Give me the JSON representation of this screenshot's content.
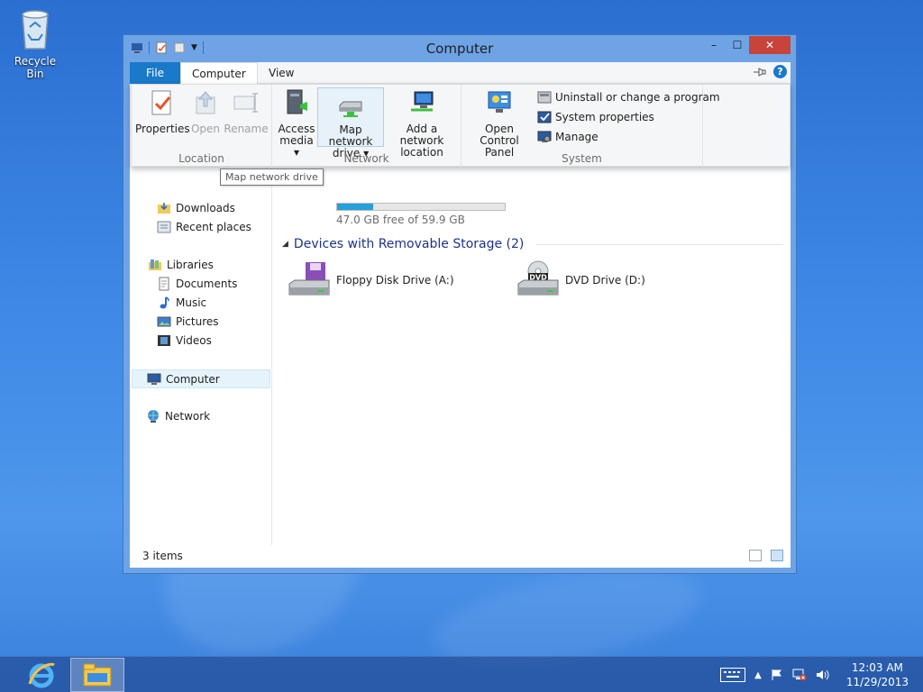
{
  "desktop": {
    "recycle_bin_label": "Recycle Bin"
  },
  "window": {
    "title": "Computer",
    "controls": {
      "minimize": "–",
      "maximize": "☐",
      "close": "✕"
    }
  },
  "ribbon_tabs": {
    "file": "File",
    "computer": "Computer",
    "view": "View"
  },
  "ribbon": {
    "location": {
      "label": "Location",
      "properties": "Properties",
      "open": "Open",
      "rename": "Rename"
    },
    "network": {
      "label": "Network",
      "access_media_l1": "Access",
      "access_media_l2": "media",
      "map_drive_l1": "Map network",
      "map_drive_l2": "drive",
      "add_location_l1": "Add a network",
      "add_location_l2": "location"
    },
    "system": {
      "label": "System",
      "control_panel_l1": "Open Control",
      "control_panel_l2": "Panel",
      "uninstall": "Uninstall or change a program",
      "system_properties": "System properties",
      "manage": "Manage"
    }
  },
  "tooltip": "Map network drive",
  "nav": {
    "downloads": "Downloads",
    "recent_places": "Recent places",
    "libraries": "Libraries",
    "documents": "Documents",
    "music": "Music",
    "pictures": "Pictures",
    "videos": "Videos",
    "computer": "Computer",
    "network": "Network"
  },
  "main": {
    "local_disk_free": "47.0 GB free of 59.9 GB",
    "local_disk_used_fraction": 0.215,
    "removable_group_title": "Devices with Removable Storage (2)",
    "floppy": "Floppy Disk Drive (A:)",
    "dvd": "DVD Drive (D:)",
    "dvd_badge": "DVD"
  },
  "status": {
    "items": "3 items"
  },
  "taskbar": {
    "time": "12:03 AM",
    "date": "11/29/2013"
  },
  "colors": {
    "file_tab": "#1979ca",
    "close_button": "#c8433a",
    "capacity_bar": "#26a0da",
    "group_header": "#1e3287"
  }
}
